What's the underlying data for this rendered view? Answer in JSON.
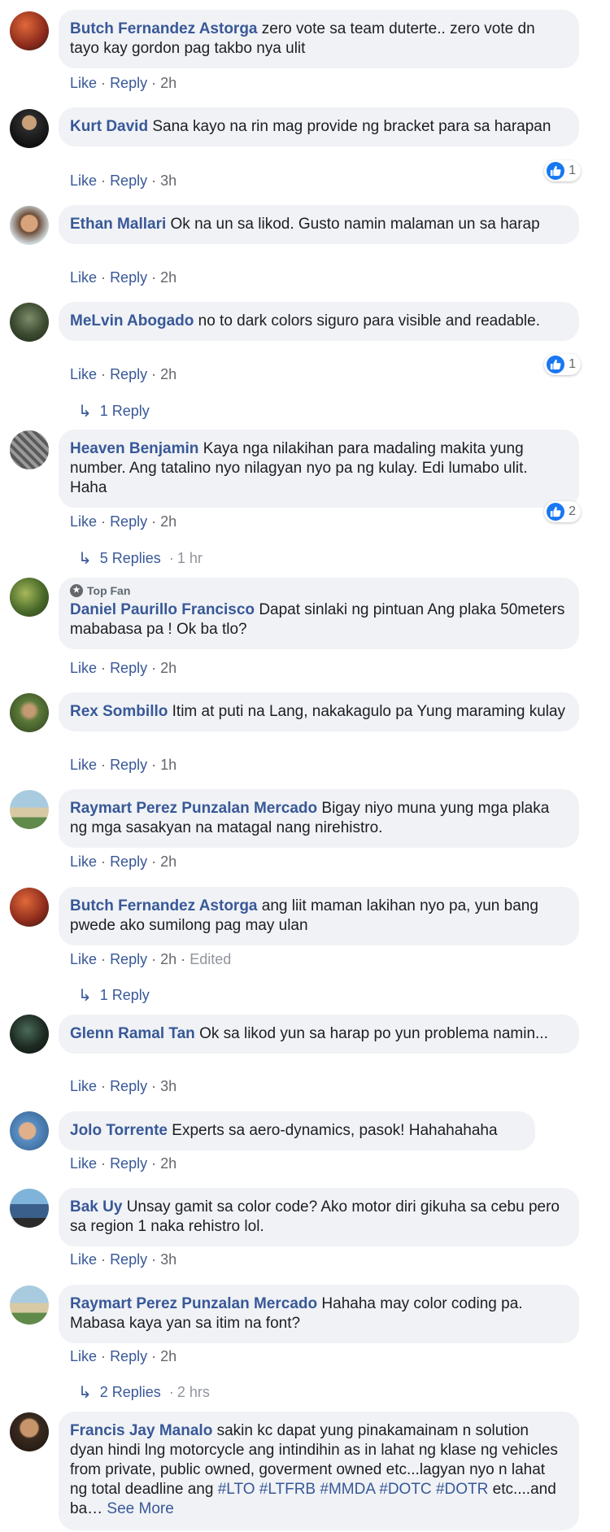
{
  "labels": {
    "like": "Like",
    "reply": "Reply",
    "dot": "·"
  },
  "comments": [
    {
      "author": "Butch Fernandez Astorga",
      "text": "zero vote sa team duterte.. zero vote dn tayo kay gordon pag takbo nya ulit",
      "time": "2h",
      "avatar": "#8b2a1b"
    },
    {
      "author": "Kurt David",
      "text": "Sana kayo na rin mag provide ng bracket para sa harapan",
      "time": "3h",
      "reactions": "1",
      "avatar": "#2b2b2b"
    },
    {
      "author": "Ethan Mallari",
      "text": "Ok na un sa likod. Gusto namin malaman un sa harap",
      "time": "2h",
      "avatar": "#b07a55"
    },
    {
      "author": "MeLvin Abogado",
      "text": "no to dark colors siguro para visible and readable.",
      "time": "2h",
      "reactions": "1",
      "replies": "1 Reply",
      "avatar": "#3b4a2f"
    },
    {
      "author": "Heaven Benjamin",
      "text": "Kaya nga nilakihan para madaling makita yung number. Ang tatalino nyo nilagyan nyo pa ng kulay. Edi lumabo ulit. Haha",
      "time": "2h",
      "reactions": "2",
      "replies": "5 Replies",
      "replies_time": "1 hr",
      "avatar": "#6d6d6d"
    },
    {
      "badge": "Top Fan",
      "author": "Daniel Paurillo Francisco",
      "text": "Dapat sinlaki ng pintuan Ang plaka 50meters mababasa pa ! Ok ba tlo?",
      "time": "2h",
      "avatar": "#4a6b2a"
    },
    {
      "author": "Rex Sombillo",
      "text": "Itim at puti na Lang, nakakagulo pa Yung maraming kulay",
      "time": "1h",
      "avatar": "#5b7a3a"
    },
    {
      "author": "Raymart Perez Punzalan Mercado",
      "text": "Bigay niyo muna yung mga plaka ng mga sasakyan na matagal nang nirehistro.",
      "time": "2h",
      "avatar": "#7fa3b8"
    },
    {
      "author": "Butch Fernandez Astorga",
      "text": "ang liit maman lakihan nyo pa, yun bang pwede ako sumilong pag may ulan",
      "time": "2h",
      "edited": "Edited",
      "replies": "1 Reply",
      "avatar": "#8b2a1b"
    },
    {
      "author": "Glenn Ramal Tan",
      "text": "Ok sa likod yun sa harap po yun problema namin...",
      "time": "3h",
      "avatar": "#1d2a22"
    },
    {
      "author": "Jolo Torrente",
      "text": "Experts sa aero-dynamics, pasok! Hahahahaha",
      "time": "2h",
      "avatar": "#5a8ec2"
    },
    {
      "author": "Bak Uy",
      "text": "Unsay gamit sa color code? Ako motor diri gikuha sa cebu pero sa region 1 naka rehistro lol.",
      "time": "3h",
      "avatar": "#3a5f8a"
    },
    {
      "author": "Raymart Perez Punzalan Mercado",
      "text": "Hahaha may color coding pa. Mabasa kaya yan sa itim na font?",
      "time": "2h",
      "replies": "2 Replies",
      "replies_time": "2 hrs",
      "avatar": "#7fa3b8"
    },
    {
      "author": "Francis Jay Manalo",
      "text": "sakin kc dapat yung pinakamainam n solution dyan hindi lng motorcycle ang intindihin as in lahat ng klase ng vehicles from private, public owned, goverment owned etc...lagyan nyo n lahat ng total deadline ang",
      "hashtags": [
        "#LTO",
        "#LTFRB",
        "#MMDA",
        "#DOTC",
        "#DOTR"
      ],
      "text_end": "etc....and ba…",
      "see_more": "See More",
      "avatar": "#3a2a1e"
    }
  ]
}
